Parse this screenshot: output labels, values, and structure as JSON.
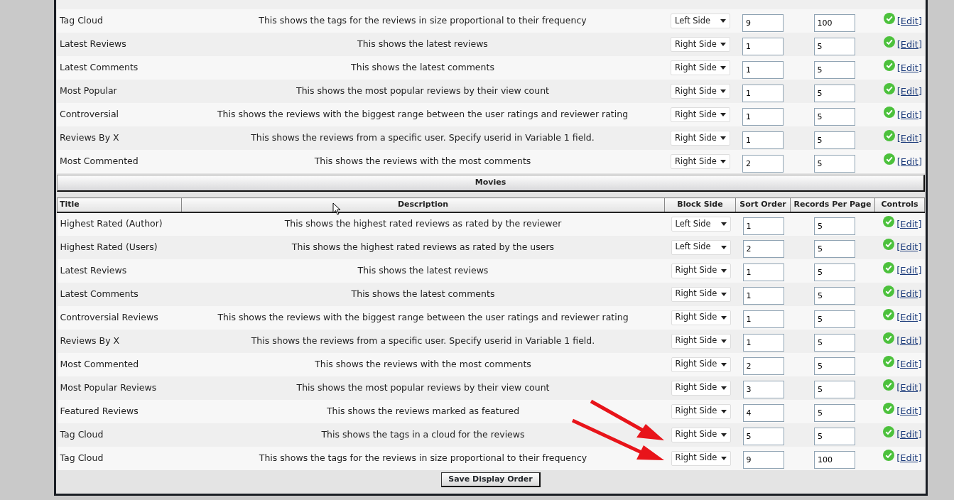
{
  "sections": [
    {
      "rows": [
        {
          "title": "Tag Cloud",
          "description": "This shows the tags for the reviews in size proportional to their frequency",
          "block_side": "Left Side",
          "sort_order": "9",
          "records_per_page": "100",
          "edit": "[Edit]"
        },
        {
          "title": "Latest Reviews",
          "description": "This shows the latest reviews",
          "block_side": "Right Side",
          "sort_order": "1",
          "records_per_page": "5",
          "edit": "[Edit]"
        },
        {
          "title": "Latest Comments",
          "description": "This shows the latest comments",
          "block_side": "Right Side",
          "sort_order": "1",
          "records_per_page": "5",
          "edit": "[Edit]"
        },
        {
          "title": "Most Popular",
          "description": "This shows the most popular reviews by their view count",
          "block_side": "Right Side",
          "sort_order": "1",
          "records_per_page": "5",
          "edit": "[Edit]"
        },
        {
          "title": "Controversial",
          "description": "This shows the reviews with the biggest range between the user ratings and reviewer rating",
          "block_side": "Right Side",
          "sort_order": "1",
          "records_per_page": "5",
          "edit": "[Edit]"
        },
        {
          "title": "Reviews By X",
          "description": "This shows the reviews from a specific user. Specify userid in Variable 1 field.",
          "block_side": "Right Side",
          "sort_order": "1",
          "records_per_page": "5",
          "edit": "[Edit]"
        },
        {
          "title": "Most Commented",
          "description": "This shows the reviews with the most comments",
          "block_side": "Right Side",
          "sort_order": "2",
          "records_per_page": "5",
          "edit": "[Edit]"
        }
      ]
    },
    {
      "title": "Movies",
      "columns": [
        "Title",
        "Description",
        "Block Side",
        "Sort Order",
        "Records Per Page",
        "Controls"
      ],
      "rows": [
        {
          "title": "Highest Rated (Author)",
          "description": "This shows the highest rated reviews as rated by the reviewer",
          "block_side": "Left Side",
          "sort_order": "1",
          "records_per_page": "5",
          "edit": "[Edit]"
        },
        {
          "title": "Highest Rated (Users)",
          "description": "This shows the highest rated reviews as rated by the users",
          "block_side": "Left Side",
          "sort_order": "2",
          "records_per_page": "5",
          "edit": "[Edit]"
        },
        {
          "title": "Latest Reviews",
          "description": "This shows the latest reviews",
          "block_side": "Right Side",
          "sort_order": "1",
          "records_per_page": "5",
          "edit": "[Edit]"
        },
        {
          "title": "Latest Comments",
          "description": "This shows the latest comments",
          "block_side": "Right Side",
          "sort_order": "1",
          "records_per_page": "5",
          "edit": "[Edit]"
        },
        {
          "title": "Controversial Reviews",
          "description": "This shows the reviews with the biggest range between the user ratings and reviewer rating",
          "block_side": "Right Side",
          "sort_order": "1",
          "records_per_page": "5",
          "edit": "[Edit]"
        },
        {
          "title": "Reviews By X",
          "description": "This shows the reviews from a specific user. Specify userid in Variable 1 field.",
          "block_side": "Right Side",
          "sort_order": "1",
          "records_per_page": "5",
          "edit": "[Edit]"
        },
        {
          "title": "Most Commented",
          "description": "This shows the reviews with the most comments",
          "block_side": "Right Side",
          "sort_order": "2",
          "records_per_page": "5",
          "edit": "[Edit]"
        },
        {
          "title": "Most Popular Reviews",
          "description": "This shows the most popular reviews by their view count",
          "block_side": "Right Side",
          "sort_order": "3",
          "records_per_page": "5",
          "edit": "[Edit]"
        },
        {
          "title": "Featured Reviews",
          "description": "This shows the reviews marked as featured",
          "block_side": "Right Side",
          "sort_order": "4",
          "records_per_page": "5",
          "edit": "[Edit]"
        },
        {
          "title": "Tag Cloud",
          "description": "This shows the tags in a cloud for the reviews",
          "block_side": "Right Side",
          "sort_order": "5",
          "records_per_page": "5",
          "edit": "[Edit]"
        },
        {
          "title": "Tag Cloud",
          "description": "This shows the tags for the reviews in size proportional to their frequency",
          "block_side": "Right Side",
          "sort_order": "9",
          "records_per_page": "100",
          "edit": "[Edit]"
        }
      ]
    }
  ],
  "save_button": "Save Display Order"
}
